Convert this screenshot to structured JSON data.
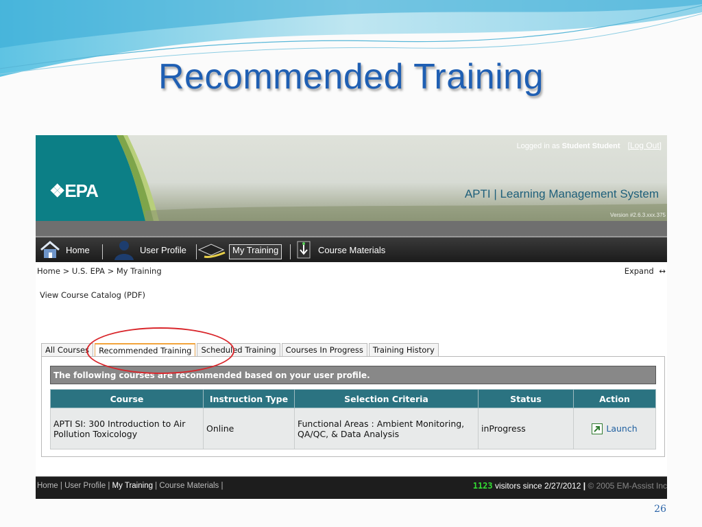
{
  "slide": {
    "title": "Recommended Training",
    "page_number": "26"
  },
  "header": {
    "logo_text": "EPA",
    "logged_in_prefix": "Logged in as",
    "user_name": "Student Student",
    "logout_label": "[Log Out]",
    "app_title": "APTI | Learning Management System",
    "version": "Version #2.6.3.xxx.375"
  },
  "nav": {
    "items": [
      {
        "label": "Home",
        "icon": "home-icon"
      },
      {
        "label": "User Profile",
        "icon": "user-icon"
      },
      {
        "label": "My Training",
        "icon": "graduation-cap-icon"
      },
      {
        "label": "Course Materials",
        "icon": "download-icon"
      }
    ]
  },
  "breadcrumb": "Home > U.S. EPA > My Training",
  "expand_label": "Expand",
  "expand_icon": "expand-arrows-icon",
  "catalog_link": "View Course Catalog (PDF)",
  "tabs": [
    {
      "label": "All Courses",
      "active": false
    },
    {
      "label": "Recommended Training",
      "active": true
    },
    {
      "label": "Scheduled Training",
      "active": false
    },
    {
      "label": "Courses In Progress",
      "active": false
    },
    {
      "label": "Training History",
      "active": false
    }
  ],
  "panel": {
    "note": "The following courses are recommended based on your user profile.",
    "columns": [
      "Course",
      "Instruction Type",
      "Selection Criteria",
      "Status",
      "Action"
    ],
    "rows": [
      {
        "course": "APTI SI: 300 Introduction to Air Pollution Toxicology",
        "instruction_type": "Online",
        "selection_criteria": "Functional Areas : Ambient Monitoring, QA/QC, & Data Analysis",
        "status": "inProgress",
        "action": "Launch"
      }
    ]
  },
  "footer": {
    "links": [
      "Home",
      "User Profile",
      "My Training",
      "Course Materials"
    ],
    "counter": "1123",
    "visitors_text": "visitors since",
    "since_date": "2/27/2012",
    "copyright": "© 2005 EM-Assist Inc"
  },
  "colors": {
    "title_blue": "#1f5fb3",
    "table_header": "#2b7381",
    "highlight_red": "#d9262b",
    "tab_accent": "#f2a33a"
  }
}
